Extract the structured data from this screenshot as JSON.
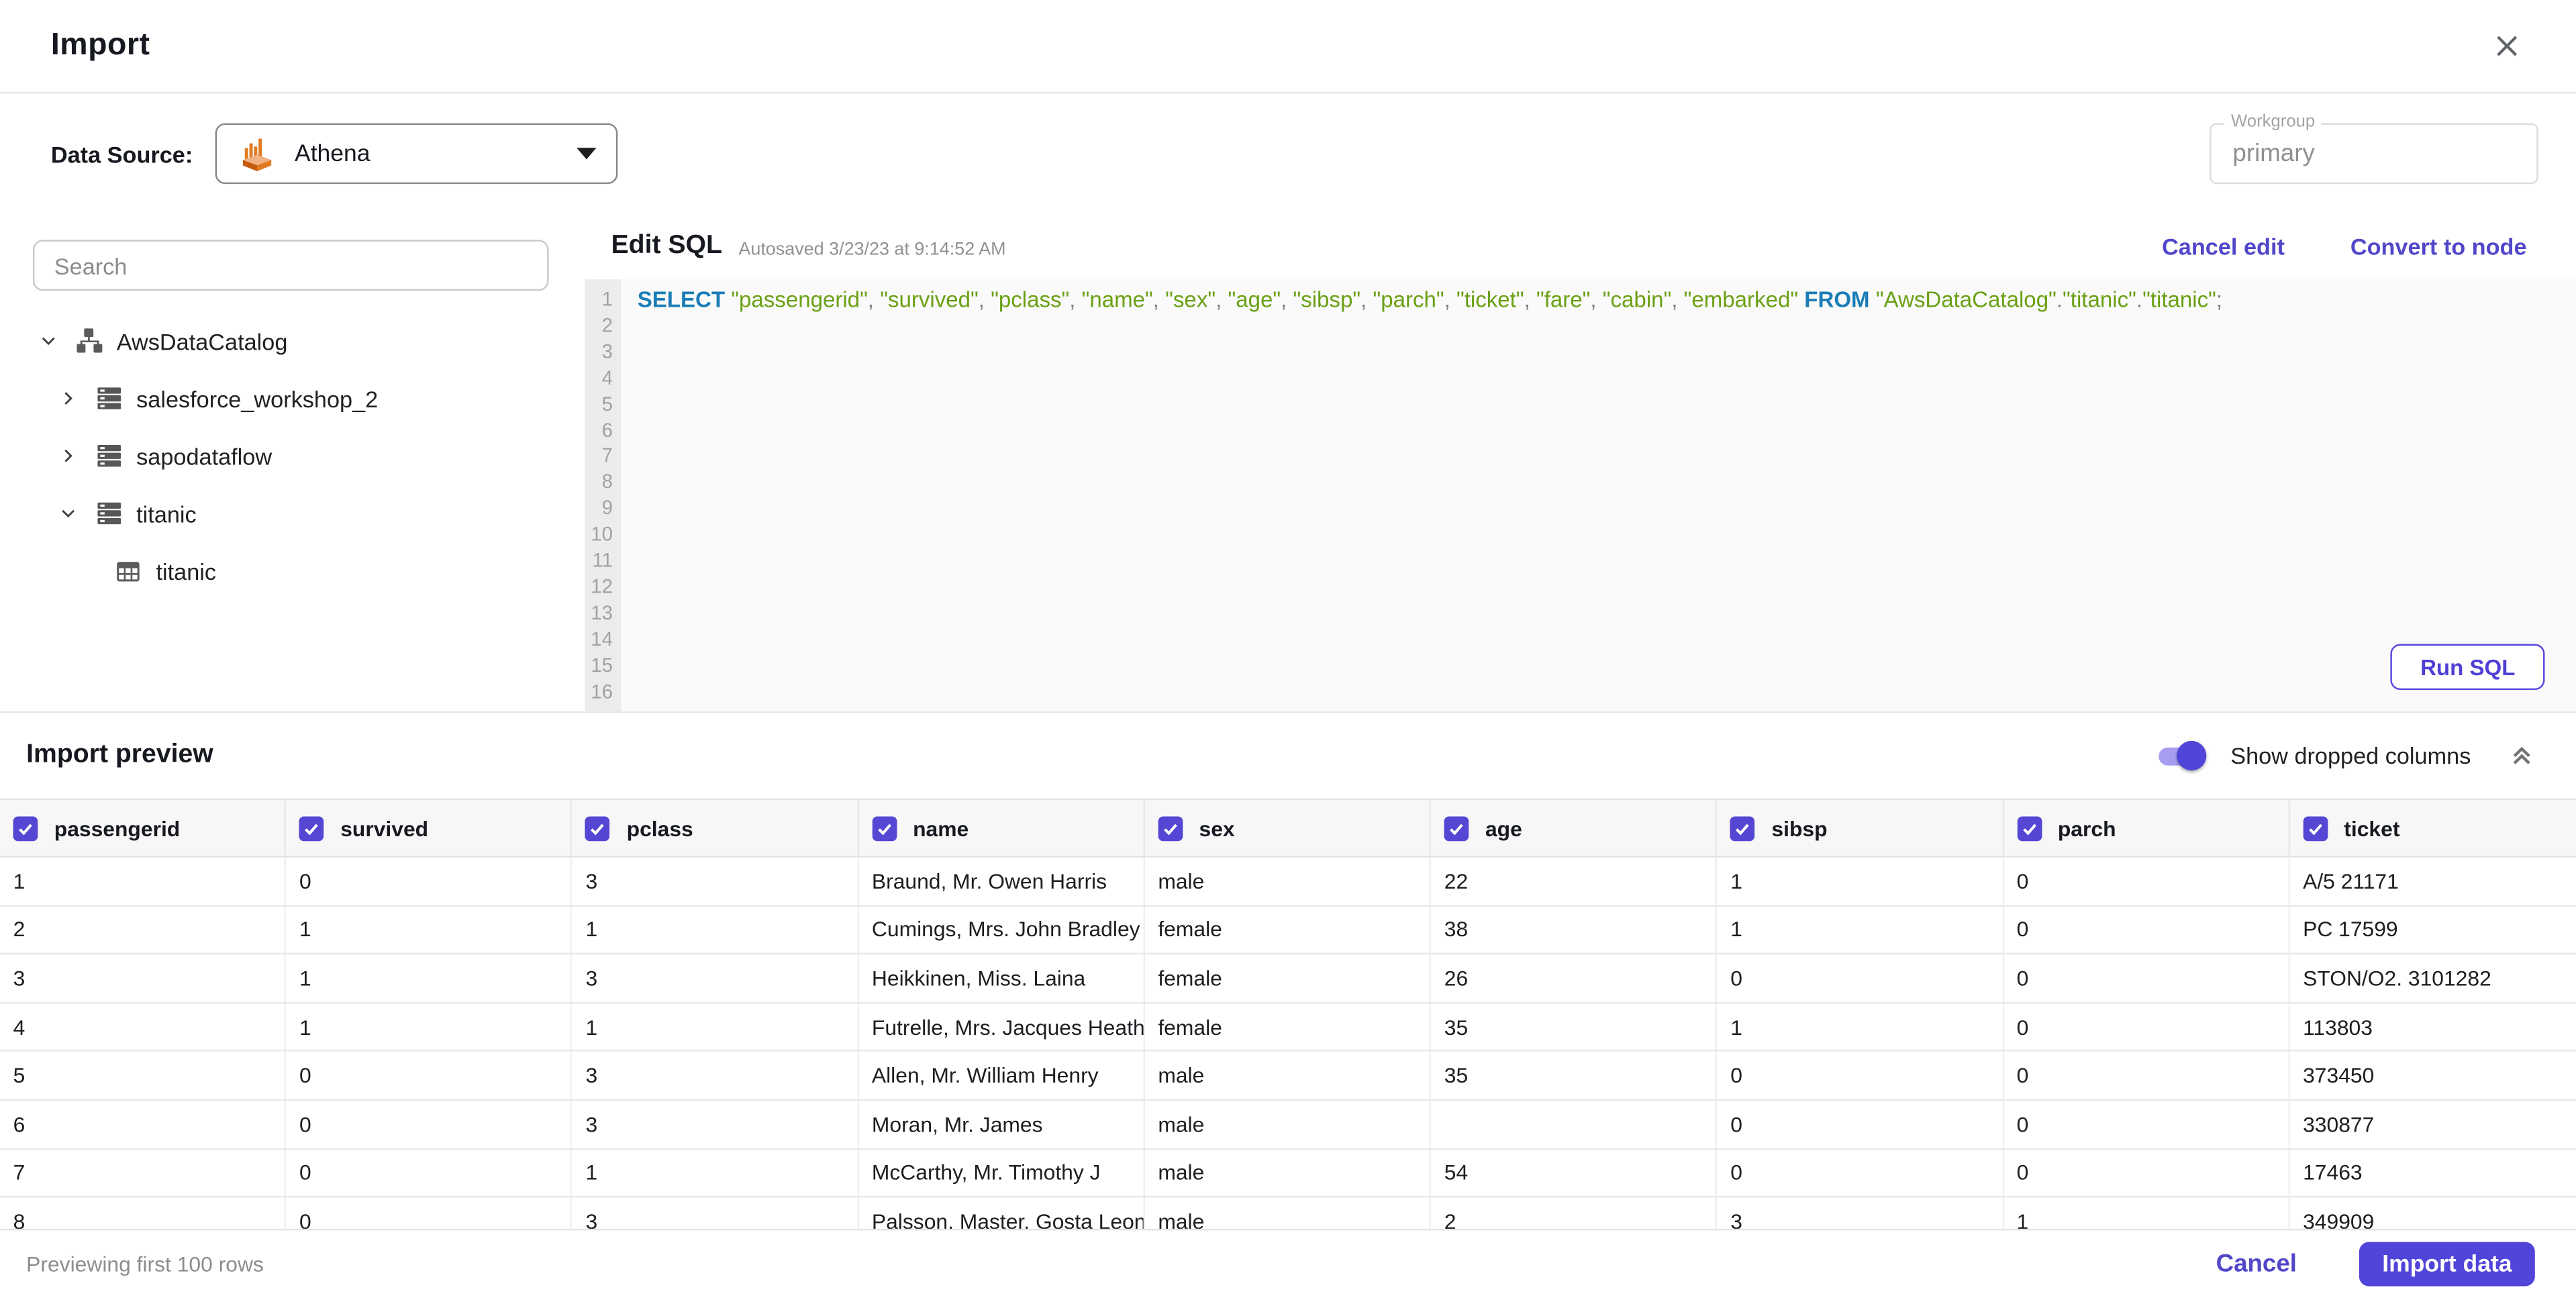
{
  "header": {
    "title": "Import"
  },
  "datasource": {
    "label": "Data Source:",
    "selected": "Athena",
    "workgroup_label": "Workgroup",
    "workgroup_value": "primary"
  },
  "sidebar": {
    "search_placeholder": "Search",
    "tree": [
      {
        "label": "AwsDataCatalog",
        "icon": "catalog-icon",
        "chevron": "down",
        "level": 0
      },
      {
        "label": "salesforce_workshop_2",
        "icon": "database-icon",
        "chevron": "right",
        "level": 1
      },
      {
        "label": "sapodataflow",
        "icon": "database-icon",
        "chevron": "right",
        "level": 1
      },
      {
        "label": "titanic",
        "icon": "database-icon",
        "chevron": "down",
        "level": 1
      },
      {
        "label": "titanic",
        "icon": "table-icon",
        "chevron": "none",
        "level": 2
      }
    ]
  },
  "sql_editor": {
    "title": "Edit SQL",
    "autosaved": "Autosaved 3/23/23 at 9:14:52 AM",
    "cancel_edit": "Cancel edit",
    "convert_to_node": "Convert to node",
    "run_sql": "Run SQL",
    "line_count": 16,
    "tokens": [
      {
        "t": "kw",
        "v": "SELECT"
      },
      {
        "t": "pun",
        "v": " "
      },
      {
        "t": "str",
        "v": "\"passengerid\""
      },
      {
        "t": "pun",
        "v": ", "
      },
      {
        "t": "str",
        "v": "\"survived\""
      },
      {
        "t": "pun",
        "v": ", "
      },
      {
        "t": "str",
        "v": "\"pclass\""
      },
      {
        "t": "pun",
        "v": ", "
      },
      {
        "t": "str",
        "v": "\"name\""
      },
      {
        "t": "pun",
        "v": ", "
      },
      {
        "t": "str",
        "v": "\"sex\""
      },
      {
        "t": "pun",
        "v": ", "
      },
      {
        "t": "str",
        "v": "\"age\""
      },
      {
        "t": "pun",
        "v": ", "
      },
      {
        "t": "str",
        "v": "\"sibsp\""
      },
      {
        "t": "pun",
        "v": ", "
      },
      {
        "t": "str",
        "v": "\"parch\""
      },
      {
        "t": "pun",
        "v": ", "
      },
      {
        "t": "str",
        "v": "\"ticket\""
      },
      {
        "t": "pun",
        "v": ", "
      },
      {
        "t": "str",
        "v": "\"fare\""
      },
      {
        "t": "pun",
        "v": ", "
      },
      {
        "t": "str",
        "v": "\"cabin\""
      },
      {
        "t": "pun",
        "v": ", "
      },
      {
        "t": "str",
        "v": "\"embarked\""
      },
      {
        "t": "pun",
        "v": " "
      },
      {
        "t": "kw",
        "v": "FROM"
      },
      {
        "t": "pun",
        "v": " "
      },
      {
        "t": "str",
        "v": "\"AwsDataCatalog\""
      },
      {
        "t": "pun",
        "v": "."
      },
      {
        "t": "str",
        "v": "\"titanic\""
      },
      {
        "t": "pun",
        "v": "."
      },
      {
        "t": "str",
        "v": "\"titanic\""
      },
      {
        "t": "pun",
        "v": ";"
      }
    ]
  },
  "preview": {
    "title": "Import preview",
    "toggle_label": "Show dropped columns",
    "toggle_on": true,
    "columns": [
      "passengerid",
      "survived",
      "pclass",
      "name",
      "sex",
      "age",
      "sibsp",
      "parch",
      "ticket"
    ],
    "rows": [
      [
        "1",
        "0",
        "3",
        "Braund, Mr. Owen Harris",
        "male",
        "22",
        "1",
        "0",
        "A/5 21171"
      ],
      [
        "2",
        "1",
        "1",
        "Cumings, Mrs. John Bradley (Florenc",
        "female",
        "38",
        "1",
        "0",
        "PC 17599"
      ],
      [
        "3",
        "1",
        "3",
        "Heikkinen, Miss. Laina",
        "female",
        "26",
        "0",
        "0",
        "STON/O2. 3101282"
      ],
      [
        "4",
        "1",
        "1",
        "Futrelle, Mrs. Jacques Heath (Lily Ma",
        "female",
        "35",
        "1",
        "0",
        "113803"
      ],
      [
        "5",
        "0",
        "3",
        "Allen, Mr. William Henry",
        "male",
        "35",
        "0",
        "0",
        "373450"
      ],
      [
        "6",
        "0",
        "3",
        "Moran, Mr. James",
        "male",
        "",
        "0",
        "0",
        "330877"
      ],
      [
        "7",
        "0",
        "1",
        "McCarthy, Mr. Timothy J",
        "male",
        "54",
        "0",
        "0",
        "17463"
      ],
      [
        "8",
        "0",
        "3",
        "Palsson, Master. Gosta Leonard",
        "male",
        "2",
        "3",
        "1",
        "349909"
      ]
    ]
  },
  "footer": {
    "note": "Previewing first 100 rows",
    "cancel_label": "Cancel",
    "import_label": "Import data"
  },
  "colors": {
    "accent_purple": "#5144d8",
    "link_purple": "#5147c9",
    "sql_keyword_blue": "#1b7db6",
    "sql_string_green": "#6aa014",
    "athena_orange": "#e07a23"
  }
}
